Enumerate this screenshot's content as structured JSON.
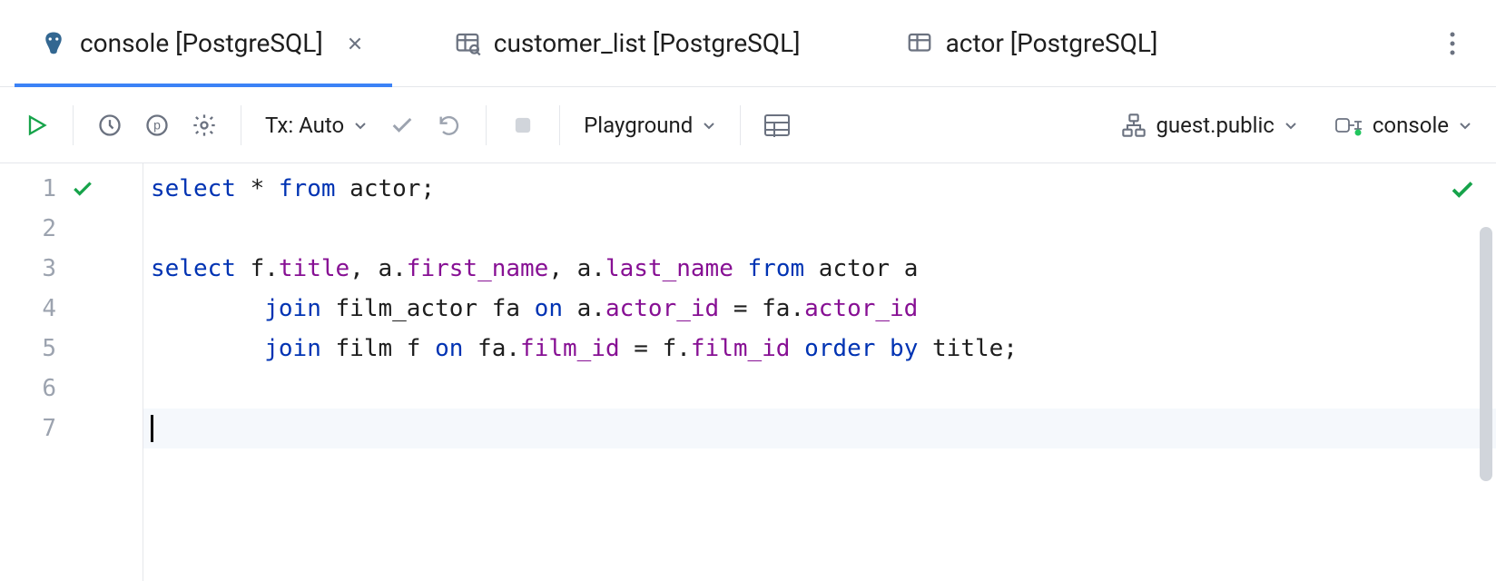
{
  "tabs": [
    {
      "label": "console [PostgreSQL]",
      "icon": "postgres",
      "active": true,
      "closable": true
    },
    {
      "label": "customer_list [PostgreSQL]",
      "icon": "table-search",
      "active": false,
      "closable": false
    },
    {
      "label": "actor [PostgreSQL]",
      "icon": "table",
      "active": false,
      "closable": false
    }
  ],
  "toolbar": {
    "tx_label": "Tx: Auto",
    "playground_label": "Playground",
    "schema_label": "guest.public",
    "console_label": "console"
  },
  "gutter": {
    "lines": [
      "1",
      "2",
      "3",
      "4",
      "5",
      "6",
      "7"
    ]
  },
  "code": {
    "l1": {
      "a": "select",
      "b": " * ",
      "c": "from",
      "d": " actor;"
    },
    "l3": {
      "a": "select",
      "b": " f.",
      "c": "title",
      "d": ", a.",
      "e": "first_name",
      "f": ", a.",
      "g": "last_name",
      "h": " ",
      "i": "from",
      "j": " actor a"
    },
    "l4": {
      "a": "        ",
      "b": "join",
      "c": " film_actor fa ",
      "d": "on",
      "e": " a.",
      "f": "actor_id",
      "g": " = fa.",
      "h": "actor_id"
    },
    "l5": {
      "a": "        ",
      "b": "join",
      "c": " film f ",
      "d": "on",
      "e": " fa.",
      "f": "film_id",
      "g": " = f.",
      "h": "film_id",
      "i": " ",
      "j": "order by",
      "k": " title;"
    }
  }
}
